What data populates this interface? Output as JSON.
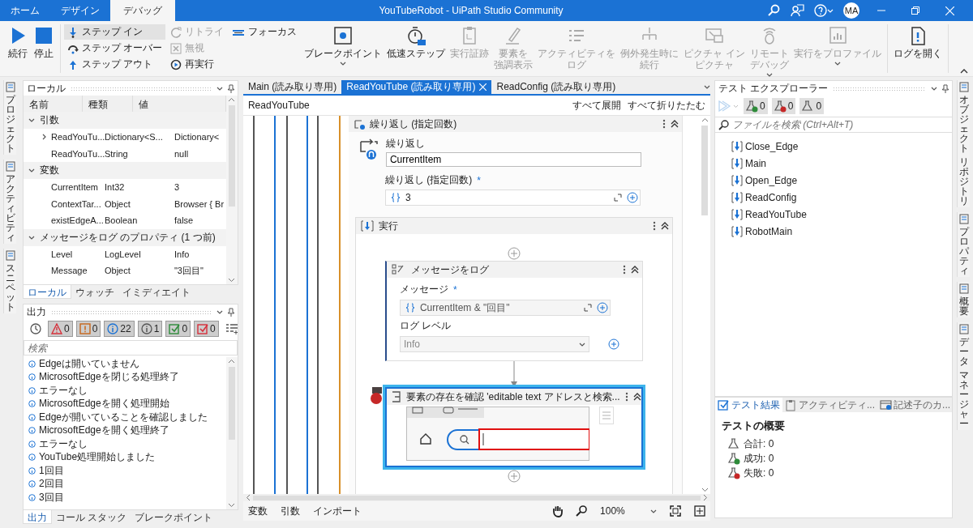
{
  "title_bar": {
    "tabs": [
      {
        "label": "ホーム",
        "selected": false
      },
      {
        "label": "デザイン",
        "selected": false
      },
      {
        "label": "デバッグ",
        "selected": true
      }
    ],
    "title": "YouTubeRobot - UiPath Studio Community",
    "avatar": "MA"
  },
  "ribbon": {
    "groups": [
      {
        "items": [
          {
            "kind": "large",
            "label": "続行",
            "disabled": false,
            "highlighted": false,
            "dropdown": false
          },
          {
            "kind": "large",
            "label": "停止",
            "disabled": false,
            "highlighted": false,
            "dropdown": false
          }
        ]
      },
      {
        "items": [
          {
            "kind": "small",
            "label": "ステップ イン",
            "disabled": false,
            "highlighted": true
          },
          {
            "kind": "small",
            "label": "ステップ オーバー",
            "disabled": false,
            "highlighted": false
          },
          {
            "kind": "small",
            "label": "ステップ アウト",
            "disabled": false,
            "highlighted": false
          },
          {
            "kind": "small",
            "label": "リトライ",
            "disabled": true,
            "highlighted": false
          },
          {
            "kind": "small",
            "label": "無視",
            "disabled": true,
            "highlighted": false
          },
          {
            "kind": "small",
            "label": "再実行",
            "disabled": false,
            "highlighted": false
          },
          {
            "kind": "small",
            "label": "フォーカス",
            "disabled": false,
            "highlighted": false
          },
          {
            "kind": "large",
            "label": "ブレークポイント",
            "disabled": false,
            "highlighted": false,
            "dropdown": true
          },
          {
            "kind": "large",
            "label": "低速ステップ",
            "disabled": false,
            "highlighted": false,
            "dropdown": false
          },
          {
            "kind": "large",
            "label": "実行証跡",
            "disabled": true,
            "highlighted": false,
            "dropdown": false
          },
          {
            "kind": "large",
            "lines": [
              "要素を",
              "強調表示"
            ],
            "disabled": true,
            "highlighted": false,
            "dropdown": false
          },
          {
            "kind": "large",
            "lines": [
              "アクティビティを",
              "ログ"
            ],
            "disabled": true,
            "highlighted": false,
            "dropdown": false
          },
          {
            "kind": "large",
            "lines": [
              "例外発生時に",
              "続行"
            ],
            "disabled": true,
            "highlighted": false,
            "dropdown": false
          },
          {
            "kind": "large",
            "lines": [
              "ピクチャ イン",
              "ピクチャ"
            ],
            "disabled": true,
            "highlighted": false,
            "dropdown": false
          },
          {
            "kind": "large",
            "lines": [
              "リモート",
              "デバッグ"
            ],
            "disabled": true,
            "highlighted": false,
            "dropdown": true
          },
          {
            "kind": "large",
            "label": "実行をプロファイル",
            "disabled": true,
            "highlighted": false,
            "dropdown": true
          }
        ]
      },
      {
        "items": [
          {
            "kind": "large",
            "label": "ログを開く",
            "disabled": false,
            "highlighted": false,
            "dropdown": false
          }
        ]
      }
    ]
  },
  "left_dock": [
    {
      "lines": [
        "プロジェクト"
      ]
    },
    {
      "lines": [
        "アクティビティ"
      ]
    },
    {
      "lines": [
        "スニペット"
      ]
    }
  ],
  "locals": {
    "title": "ローカル",
    "columns": [
      "名前",
      "種類",
      "値"
    ],
    "groups": [
      {
        "label": "引数",
        "expanded": true,
        "rows": [
          {
            "cells": [
              "ReadYouTu...",
              "Dictionary<S...",
              "Dictionary<"
            ],
            "expandable": true
          },
          {
            "cells": [
              "ReadYouTu...",
              "String",
              "null"
            ],
            "expandable": false
          }
        ]
      },
      {
        "label": "変数",
        "expanded": true,
        "rows": [
          {
            "cells": [
              "CurrentItem",
              "Int32",
              "3"
            ],
            "expandable": false
          },
          {
            "cells": [
              "ContextTar...",
              "Object",
              "Browser { Br"
            ],
            "expandable": false
          },
          {
            "cells": [
              "existEdgeA...",
              "Boolean",
              "false"
            ],
            "expandable": false
          }
        ]
      },
      {
        "label": "メッセージをログ のプロパティ (1 つ前)",
        "expanded": true,
        "rows": [
          {
            "cells": [
              "Level",
              "LogLevel",
              "Info"
            ],
            "expandable": false
          },
          {
            "cells": [
              "Message",
              "Object",
              "\"3回目\""
            ],
            "expandable": false
          }
        ]
      }
    ],
    "tabs": [
      {
        "label": "ローカル",
        "selected": true
      },
      {
        "label": "ウォッチ",
        "selected": false
      },
      {
        "label": "イミディエイト",
        "selected": false
      }
    ]
  },
  "output": {
    "title": "出力",
    "filters": [
      {
        "kind": "warning",
        "count": "0",
        "selected": true
      },
      {
        "kind": "error",
        "count": "0",
        "selected": true
      },
      {
        "kind": "info",
        "count": "22",
        "selected": true
      },
      {
        "kind": "trace",
        "count": "1",
        "selected": true
      },
      {
        "kind": "success",
        "count": "0",
        "selected": true
      },
      {
        "kind": "failure",
        "count": "0",
        "selected": true
      }
    ],
    "placeholder": "検索",
    "lines": [
      "Edgeは開いていません",
      "MicrosoftEdgeを閉じる処理終了",
      "エラーなし",
      "MicrosoftEdgeを開く処理開始",
      "Edgeが開いていることを確認しました",
      "MicrosoftEdgeを開く処理終了",
      "エラーなし",
      "YouTube処理開始しました",
      "1回目",
      "2回目",
      "3回目"
    ],
    "tabs": [
      {
        "label": "出力",
        "selected": true
      },
      {
        "label": "コール スタック",
        "selected": false
      },
      {
        "label": "ブレークポイント",
        "selected": false
      }
    ]
  },
  "editor": {
    "tabs": [
      {
        "label": "Main (読み取り専用)",
        "selected": false
      },
      {
        "label": "ReadYouTube (読み取り専用)",
        "selected": true
      },
      {
        "label": "ReadConfig (読み取り専用)",
        "selected": false
      }
    ],
    "breadcrumb": "ReadYouTube",
    "actions": [
      "すべて展開",
      "すべて折りたたむ"
    ],
    "loop": {
      "title": "繰り返し (指定回数)",
      "var_label": "繰り返し",
      "var_value": "CurrentItem",
      "count_label": "繰り返し (指定回数)",
      "required_mark": "*",
      "count_value": "3",
      "body": {
        "title": "実行",
        "activities": [
          {
            "kind": "log",
            "title": "メッセージをログ",
            "selected": false,
            "breakpoint": false,
            "message_label": "メッセージ",
            "required_mark": "*",
            "message_value": "CurrentItem & \"回目\"",
            "level_label": "ログ レベル",
            "level_value": "Info"
          },
          {
            "kind": "element-exists",
            "title": "要素の存在を確認 'editable text アドレスと検索...",
            "selected": true,
            "breakpoint": true
          }
        ]
      }
    },
    "bottom_tabs": [
      "変数",
      "引数",
      "インポート"
    ],
    "zoom": "100%"
  },
  "test_explorer": {
    "title": "テスト エクスプローラー",
    "run_disabled": true,
    "filters": [
      {
        "kind": "passed",
        "count": "0"
      },
      {
        "kind": "failed",
        "count": "0"
      },
      {
        "kind": "total",
        "count": "0"
      }
    ],
    "placeholder": "ファイルを検索 (Ctrl+Alt+T)",
    "items": [
      "Close_Edge",
      "Main",
      "Open_Edge",
      "ReadConfig",
      "ReadYouTube",
      "RobotMain"
    ],
    "tabs": [
      {
        "label": "テスト結果",
        "selected": true
      },
      {
        "label": "アクティビティ...",
        "selected": false
      },
      {
        "label": "記述子のカ...",
        "selected": false
      }
    ],
    "summary": {
      "title": "テストの概要",
      "rows": [
        {
          "kind": "total",
          "text": "合計: 0"
        },
        {
          "kind": "passed",
          "text": "成功: 0"
        },
        {
          "kind": "failed",
          "text": "失敗: 0"
        }
      ]
    }
  },
  "right_dock": [
    {
      "lines": [
        "オブジェクト",
        "リポジトリ"
      ]
    },
    {
      "lines": [
        "プロパティ"
      ]
    },
    {
      "lines": [
        "概要"
      ]
    },
    {
      "lines": [
        "データ",
        "マネージャー"
      ]
    }
  ]
}
